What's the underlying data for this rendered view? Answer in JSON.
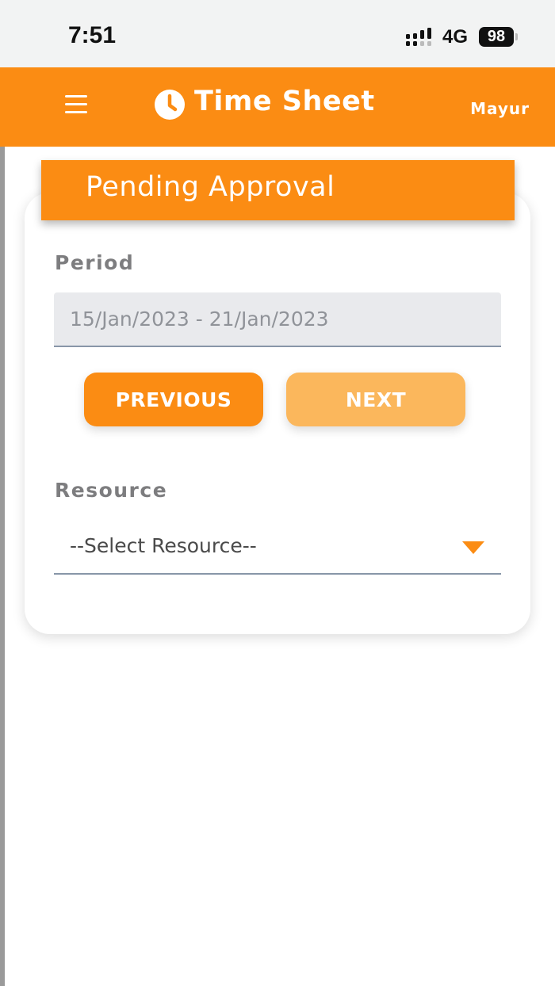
{
  "status_bar": {
    "time": "7:51",
    "network": "4G",
    "battery": "98",
    "icons": [
      "signal-icon",
      "battery-icon"
    ]
  },
  "header": {
    "title": "Time Sheet",
    "user": "Mayur",
    "background_color": "#fb8c13",
    "icons": [
      "menu-icon",
      "clock-icon"
    ]
  },
  "card": {
    "title": "Pending Approval",
    "period": {
      "label": "Period",
      "value": "15/Jan/2023 - 21/Jan/2023"
    },
    "buttons": {
      "previous": "PREVIOUS",
      "next": "NEXT",
      "previous_color": "#fb8c13",
      "next_color": "#fbb75c"
    },
    "resource": {
      "label": "Resource",
      "selected": "--Select Resource--",
      "icon": "dropdown-triangle-icon"
    }
  }
}
